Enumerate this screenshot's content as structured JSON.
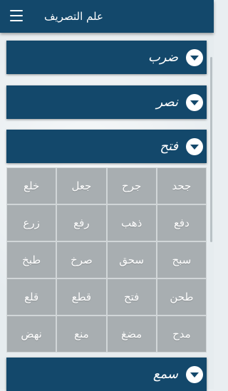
{
  "app": {
    "title": "علم التصريف"
  },
  "panels": [
    {
      "label": "ضرب"
    },
    {
      "label": "نصر"
    },
    {
      "label": "فتح"
    },
    {
      "label": "سمع"
    }
  ],
  "grid": {
    "rows": [
      [
        "خلع",
        "جعل",
        "جرح",
        "جحد"
      ],
      [
        "زرع",
        "رفع",
        "ذهب",
        "دفع"
      ],
      [
        "طبخ",
        "صرخ",
        "سحق",
        "سبح"
      ],
      [
        "قلع",
        "قطع",
        "فتح",
        "طحن"
      ],
      [
        "نهض",
        "منع",
        "مضغ",
        "مدح"
      ]
    ]
  },
  "icons": {
    "menu": "hamburger-menu-icon",
    "toggle": "chevron-down-icon"
  },
  "colors": {
    "primary": "#13486b",
    "cell": "#a8aeb1",
    "text": "#ffffff"
  }
}
